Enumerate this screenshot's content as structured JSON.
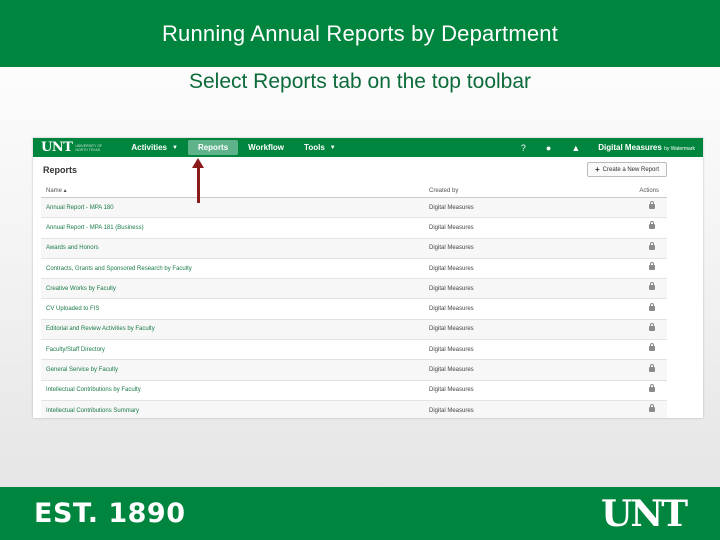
{
  "slide": {
    "title": "Running Annual Reports by Department",
    "subtitle": "Select Reports tab on the top toolbar"
  },
  "app": {
    "logo_text": "UNT",
    "logo_subtext": "UNIVERSITY OF NORTH TEXAS",
    "nav": {
      "activities": "Activities",
      "reports": "Reports",
      "workflow": "Workflow",
      "tools": "Tools"
    },
    "help_icon": "?",
    "brand": "Digital Measures",
    "brand_sub": "by Watermark",
    "page_heading": "Reports",
    "create_button": "Create a New Report",
    "columns": {
      "name": "Name ▴",
      "created_by": "Created by",
      "actions": "Actions"
    },
    "reports": [
      {
        "name": "Annual Report - MPA 180",
        "created_by": "Digital Measures"
      },
      {
        "name": "Annual Report - MPA 181 (Business)",
        "created_by": "Digital Measures"
      },
      {
        "name": "Awards and Honors",
        "created_by": "Digital Measures"
      },
      {
        "name": "Contracts, Grants and Sponsored Research by Faculty",
        "created_by": "Digital Measures"
      },
      {
        "name": "Creative Works by Faculty",
        "created_by": "Digital Measures"
      },
      {
        "name": "CV Uploaded to FIS",
        "created_by": "Digital Measures"
      },
      {
        "name": "Editorial and Review Activities by Faculty",
        "created_by": "Digital Measures"
      },
      {
        "name": "Faculty/Staff Directory",
        "created_by": "Digital Measures"
      },
      {
        "name": "General Service by Faculty",
        "created_by": "Digital Measures"
      },
      {
        "name": "Intellectual Contributions by Faculty",
        "created_by": "Digital Measures"
      },
      {
        "name": "Intellectual Contributions Summary",
        "created_by": "Digital Measures"
      }
    ]
  },
  "footer": {
    "est": "EST. 1890",
    "logo": "UNT"
  },
  "colors": {
    "brand_green": "#00853e",
    "active_tab": "#5fb38a",
    "arrow": "#8b1a1a"
  }
}
